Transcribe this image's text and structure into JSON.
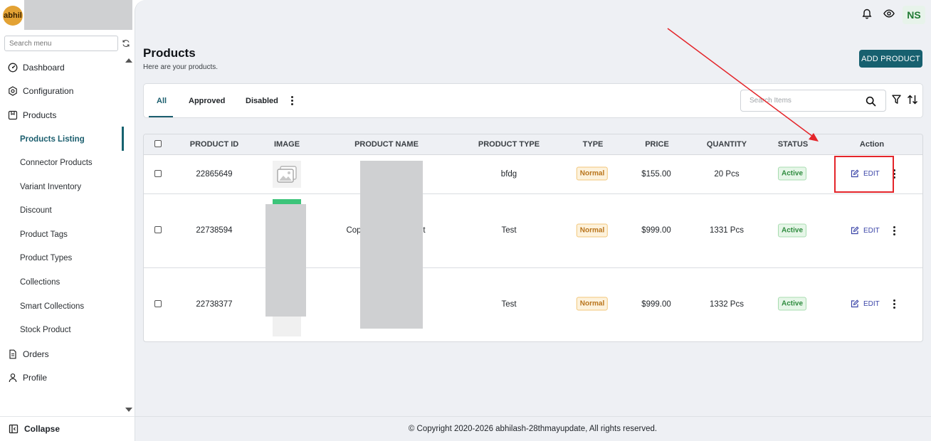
{
  "brand": {
    "logo_text": "abhil"
  },
  "sidebar": {
    "search_placeholder": "Search menu",
    "items": [
      {
        "label": "Dashboard",
        "icon": "dashboard-icon"
      },
      {
        "label": "Configuration",
        "icon": "settings-hex-icon"
      },
      {
        "label": "Products",
        "icon": "product-box-icon"
      }
    ],
    "product_sub_items": [
      "Products Listing",
      "Connector Products",
      "Variant Inventory",
      "Discount",
      "Product Tags",
      "Product Types",
      "Collections",
      "Smart Collections",
      "Stock Product"
    ],
    "active_sub_item": "Products Listing",
    "bottom_items": [
      {
        "label": "Orders",
        "icon": "document-icon"
      },
      {
        "label": "Profile",
        "icon": "user-icon"
      }
    ],
    "collapse_label": "Collapse"
  },
  "header": {
    "icons": [
      "bell-icon",
      "eye-icon"
    ],
    "avatar_initials": "NS"
  },
  "page": {
    "title": "Products",
    "subtitle": "Here are your products.",
    "add_button": "ADD PRODUCT"
  },
  "tabs": {
    "items": [
      "All",
      "Approved",
      "Disabled"
    ],
    "active": "All",
    "search_placeholder": "Search Items"
  },
  "table": {
    "columns": [
      "PRODUCT ID",
      "IMAGE",
      "PRODUCT NAME",
      "PRODUCT TYPE",
      "TYPE",
      "PRICE",
      "QUANTITY",
      "STATUS",
      "Action"
    ],
    "rows": [
      {
        "id": "22865649",
        "name": "",
        "product_type": "bfdg",
        "type": "Normal",
        "price": "$155.00",
        "quantity": "20 Pcs",
        "status": "Active",
        "action": "EDIT"
      },
      {
        "id": "22738594",
        "name_left": "Cop",
        "name_right": "t",
        "product_type": "Test",
        "type": "Normal",
        "price": "$999.00",
        "quantity": "1331 Pcs",
        "status": "Active",
        "action": "EDIT"
      },
      {
        "id": "22738377",
        "name": "",
        "product_type": "Test",
        "type": "Normal",
        "price": "$999.00",
        "quantity": "1332 Pcs",
        "status": "Active",
        "action": "EDIT"
      }
    ]
  },
  "footer": {
    "text": "© Copyright 2020-2026 abhilash-28thmayupdate, All rights reserved."
  },
  "colors": {
    "accent": "#17606f",
    "annotation": "#e4252a"
  }
}
